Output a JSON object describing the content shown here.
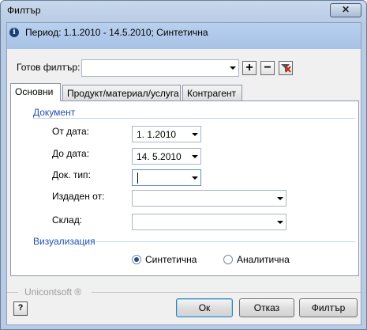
{
  "window": {
    "title": "Филтър",
    "close_label": "✕"
  },
  "info": {
    "text": "Период: 1.1.2010 - 14.5.2010; Синтетична",
    "icon": "info-icon"
  },
  "filter": {
    "label": "Готов филтър:",
    "value": "",
    "add_icon": "plus-icon",
    "remove_icon": "minus-icon",
    "clear_icon": "clear-filter-icon"
  },
  "tabs": [
    {
      "label": "Основни",
      "active": true
    },
    {
      "label": "Продукт/материал/услуга",
      "active": false
    },
    {
      "label": "Контрагент",
      "active": false
    }
  ],
  "document": {
    "title": "Документ",
    "from_date": {
      "label": "От дата:",
      "value": "1.  1.2010"
    },
    "to_date": {
      "label": "До дата:",
      "value": "14.  5.2010"
    },
    "doc_type": {
      "label": "Док. тип:",
      "value": ""
    },
    "issued_by": {
      "label": "Издаден от:",
      "value": ""
    },
    "warehouse": {
      "label": "Склад:",
      "value": ""
    }
  },
  "visualization": {
    "title": "Визуализация",
    "options": [
      {
        "label": "Синтетична",
        "checked": true
      },
      {
        "label": "Аналитична",
        "checked": false
      }
    ]
  },
  "footer": {
    "brand": "Unicontsoft ®",
    "help_icon": "help-icon",
    "ok_label": "Ок",
    "cancel_label": "Отказ",
    "filter_label": "Филтър"
  }
}
